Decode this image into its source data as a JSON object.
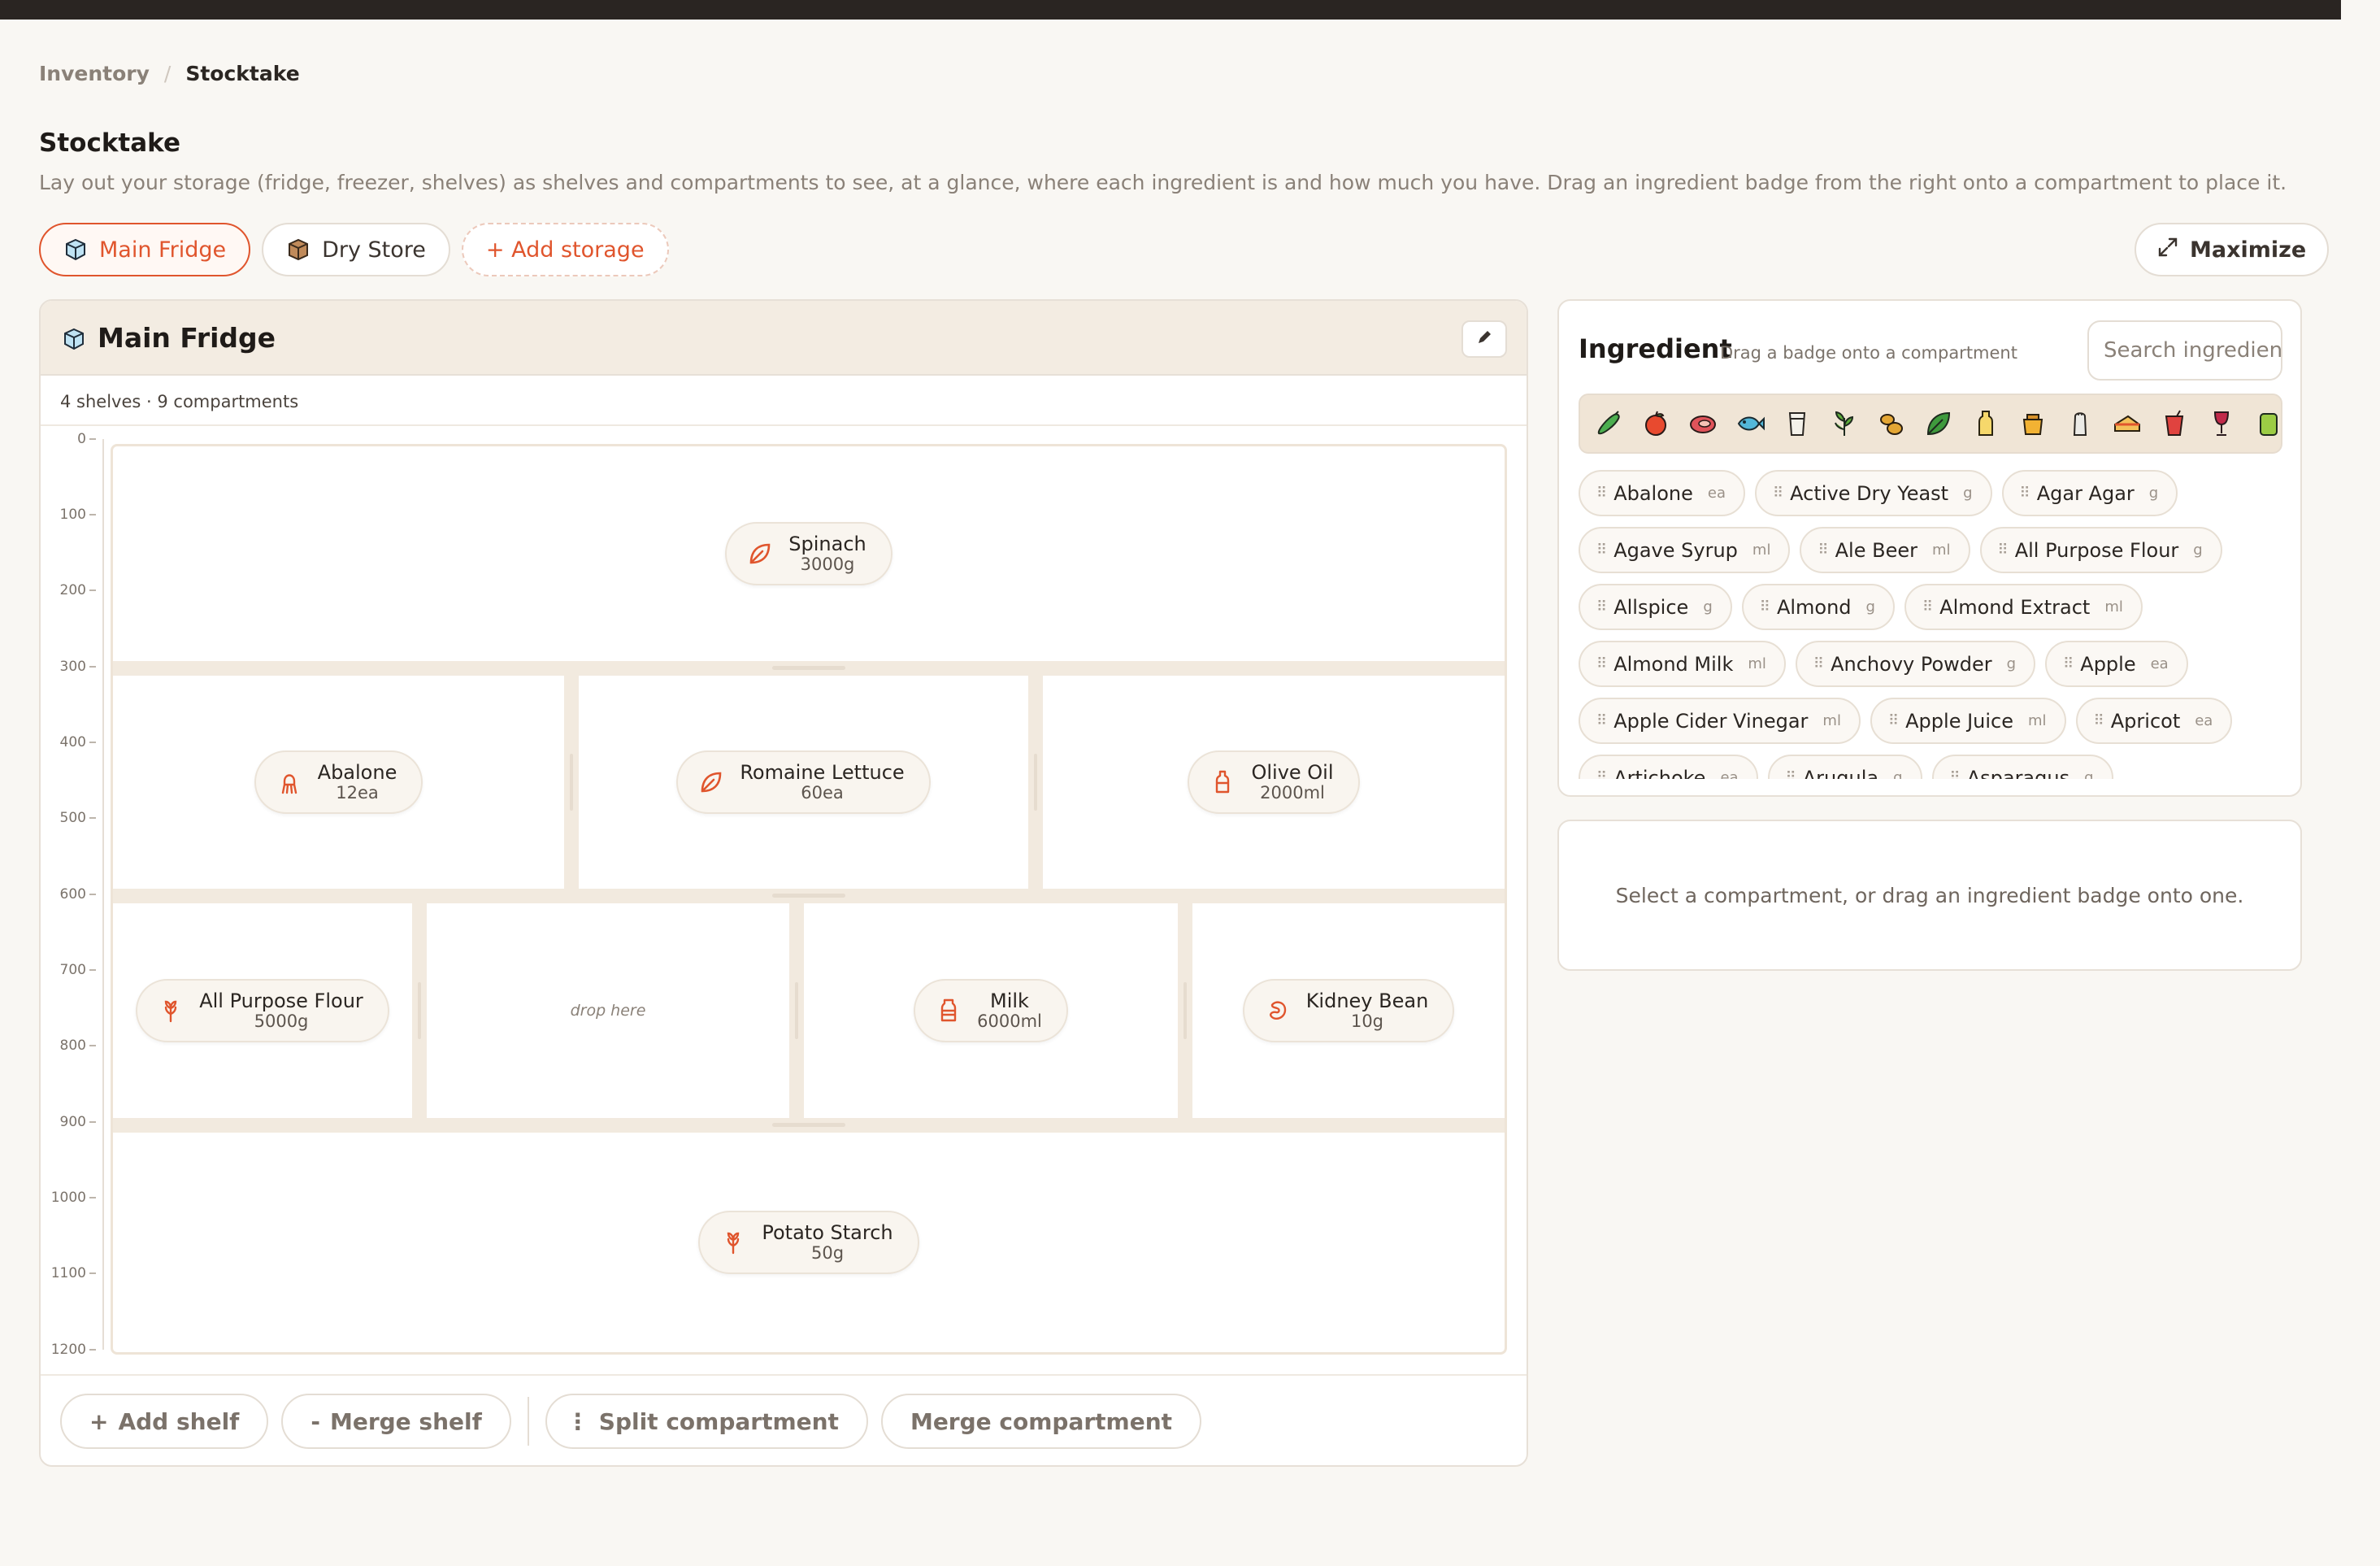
{
  "breadcrumb": {
    "parent": "Inventory",
    "separator": "/",
    "current": "Stocktake"
  },
  "page": {
    "title": "Stocktake",
    "description": "Lay out your storage (fridge, freezer, shelves) as shelves and compartments to see, at a glance, where each ingredient is and how much you have. Drag an ingredient badge from the right onto a compartment to place it."
  },
  "tabs": {
    "main_fridge": "Main Fridge",
    "dry_store": "Dry Store",
    "add_storage": "+  Add storage"
  },
  "maximize_label": "Maximize",
  "storage": {
    "title": "Main Fridge",
    "meta": "4 shelves · 9 compartments",
    "axis_ticks": [
      "0",
      "100",
      "200",
      "300",
      "400",
      "500",
      "600",
      "700",
      "800",
      "900",
      "1000",
      "1100",
      "1200"
    ],
    "items": {
      "spinach": {
        "name": "Spinach",
        "qty": "3000g",
        "icon": "leaf-icon"
      },
      "abalone": {
        "name": "Abalone",
        "qty": "12ea",
        "icon": "squid-icon"
      },
      "romaine": {
        "name": "Romaine Lettuce",
        "qty": "60ea",
        "icon": "leaf-icon"
      },
      "olive_oil": {
        "name": "Olive Oil",
        "qty": "2000ml",
        "icon": "bottle-icon"
      },
      "flour": {
        "name": "All Purpose Flour",
        "qty": "5000g",
        "icon": "wheat-icon"
      },
      "empty": {
        "drop_hint": "drop here"
      },
      "milk": {
        "name": "Milk",
        "qty": "6000ml",
        "icon": "bottle-icon"
      },
      "kidney_bean": {
        "name": "Kidney Bean",
        "qty": "10g",
        "icon": "bean-icon"
      },
      "potato_starch": {
        "name": "Potato Starch",
        "qty": "50g",
        "icon": "wheat-icon"
      }
    },
    "footer": {
      "add_shelf": "Add shelf",
      "add_shelf_symbol": "+",
      "merge_shelf": "Merge shelf",
      "merge_shelf_symbol": "-",
      "split_compartment": "Split compartment",
      "split_symbol": "⋮",
      "merge_compartment": "Merge compartment"
    }
  },
  "ingredient_panel": {
    "title": "Ingredient",
    "hint": "Drag a badge onto a compartment",
    "search_placeholder": "Search ingredient",
    "categories": [
      "vegetable-icon",
      "fruit-icon",
      "meat-icon",
      "fish-icon",
      "dairy-icon",
      "herb-icon",
      "legume-icon",
      "leafy-icon",
      "oil-icon",
      "sweetener-icon",
      "seasoning-icon",
      "bakery-icon",
      "beverage-icon",
      "wine-icon",
      "canned-icon"
    ],
    "list": [
      {
        "name": "Abalone",
        "unit": "ea"
      },
      {
        "name": "Active Dry Yeast",
        "unit": "g"
      },
      {
        "name": "Agar Agar",
        "unit": "g"
      },
      {
        "name": "Agave Syrup",
        "unit": "ml"
      },
      {
        "name": "Ale Beer",
        "unit": "ml"
      },
      {
        "name": "All Purpose Flour",
        "unit": "g"
      },
      {
        "name": "Allspice",
        "unit": "g"
      },
      {
        "name": "Almond",
        "unit": "g"
      },
      {
        "name": "Almond Extract",
        "unit": "ml"
      },
      {
        "name": "Almond Milk",
        "unit": "ml"
      },
      {
        "name": "Anchovy Powder",
        "unit": "g"
      },
      {
        "name": "Apple",
        "unit": "ea"
      },
      {
        "name": "Apple Cider Vinegar",
        "unit": "ml"
      },
      {
        "name": "Apple Juice",
        "unit": "ml"
      },
      {
        "name": "Apricot",
        "unit": "ea"
      },
      {
        "name": "Artichoke",
        "unit": "ea"
      },
      {
        "name": "Arugula",
        "unit": "g"
      },
      {
        "name": "Asparagus",
        "unit": "g"
      }
    ]
  },
  "detail_panel": {
    "empty_text": "Select a compartment, or drag an ingredient badge onto one."
  },
  "colors": {
    "accent": "#e0552d",
    "shelf": "#f2eadf",
    "header": "#f3ece2",
    "background": "#f9f7f3"
  }
}
